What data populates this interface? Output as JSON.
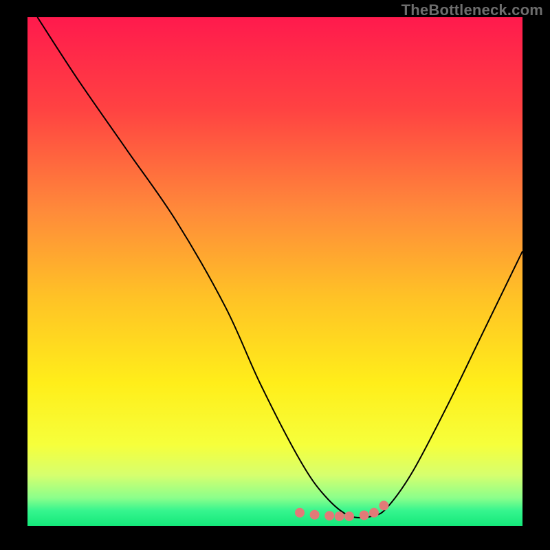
{
  "watermark": "TheBottleneck.com",
  "chart_data": {
    "type": "line",
    "title": "",
    "xlabel": "",
    "ylabel": "",
    "xlim": [
      0,
      100
    ],
    "ylim": [
      0,
      100
    ],
    "series": [
      {
        "name": "curve",
        "x": [
          2,
          10,
          20,
          30,
          40,
          47,
          55,
          60,
          65,
          70,
          73,
          78,
          85,
          92,
          100
        ],
        "y": [
          100,
          88,
          74,
          60,
          43,
          28,
          13,
          6,
          2,
          2,
          4,
          11,
          24,
          38,
          54
        ]
      }
    ],
    "highlight": {
      "dots_x": [
        55,
        58,
        61,
        63,
        65,
        68,
        70,
        72
      ],
      "dots_y": [
        2.6,
        2.2,
        2.0,
        1.9,
        1.9,
        2.1,
        2.6,
        4.0
      ],
      "color": "#e27a78"
    },
    "gradient_stops": [
      {
        "offset": 0.0,
        "color": "#ff1a4d"
      },
      {
        "offset": 0.18,
        "color": "#ff4242"
      },
      {
        "offset": 0.38,
        "color": "#ff8a3a"
      },
      {
        "offset": 0.55,
        "color": "#ffc226"
      },
      {
        "offset": 0.72,
        "color": "#ffee1a"
      },
      {
        "offset": 0.84,
        "color": "#f6ff3b"
      },
      {
        "offset": 0.9,
        "color": "#d6ff6e"
      },
      {
        "offset": 0.945,
        "color": "#8bff8b"
      },
      {
        "offset": 0.97,
        "color": "#36f58e"
      },
      {
        "offset": 1.0,
        "color": "#14e87a"
      }
    ]
  }
}
